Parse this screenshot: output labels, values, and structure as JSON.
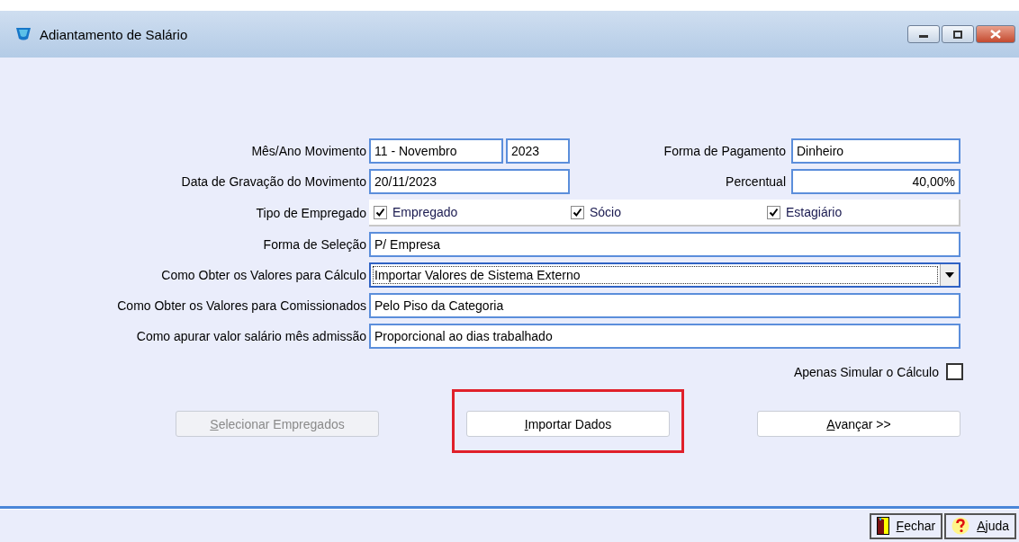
{
  "window": {
    "title": "Adiantamento de Salário"
  },
  "form": {
    "rows": [
      {
        "kind": "split",
        "label": "Mês/Ano Movimento",
        "fields": [
          {
            "kind": "text",
            "value": "11 - Novembro"
          },
          {
            "kind": "text",
            "value": "2023"
          }
        ],
        "right_label": "Forma de Pagamento",
        "right_field": {
          "kind": "text",
          "value": "Dinheiro"
        }
      },
      {
        "kind": "split",
        "label": "Data de Gravação do Movimento",
        "fields": [
          {
            "kind": "text",
            "value": "20/11/2023"
          }
        ],
        "right_label": "Percentual",
        "right_field": {
          "kind": "number",
          "value": "40,00%"
        }
      },
      {
        "kind": "checkboxes",
        "label": "Tipo de Empregado",
        "options": [
          {
            "label": "Empregado",
            "checked": true
          },
          {
            "label": "Sócio",
            "checked": true
          },
          {
            "label": "Estagiário",
            "checked": true
          }
        ]
      },
      {
        "kind": "text",
        "label": "Forma de Seleção",
        "value": "P/ Empresa"
      },
      {
        "kind": "dropdown",
        "label": "Como Obter os Valores para Cálculo",
        "value": "Importar Valores de Sistema Externo",
        "focused": true
      },
      {
        "kind": "text",
        "label": "Como Obter os Valores para Comissionados",
        "value": "Pelo Piso da Categoria"
      },
      {
        "kind": "text",
        "label": "Como apurar valor salário mês admissão",
        "value": "Proporcional ao dias trabalhado"
      }
    ]
  },
  "simulate": {
    "label": "Apenas Simular o Cálculo",
    "checked": false
  },
  "buttons": [
    {
      "label": "Selecionar Empregados",
      "disabled": true,
      "highlighted": false
    },
    {
      "label": "Importar Dados",
      "disabled": false,
      "highlighted": true
    },
    {
      "label": "Avançar >>",
      "disabled": false,
      "highlighted": false
    }
  ],
  "footer_buttons": [
    {
      "kind": "close",
      "label": "Fechar"
    },
    {
      "kind": "help",
      "label": "Ajuda"
    }
  ]
}
